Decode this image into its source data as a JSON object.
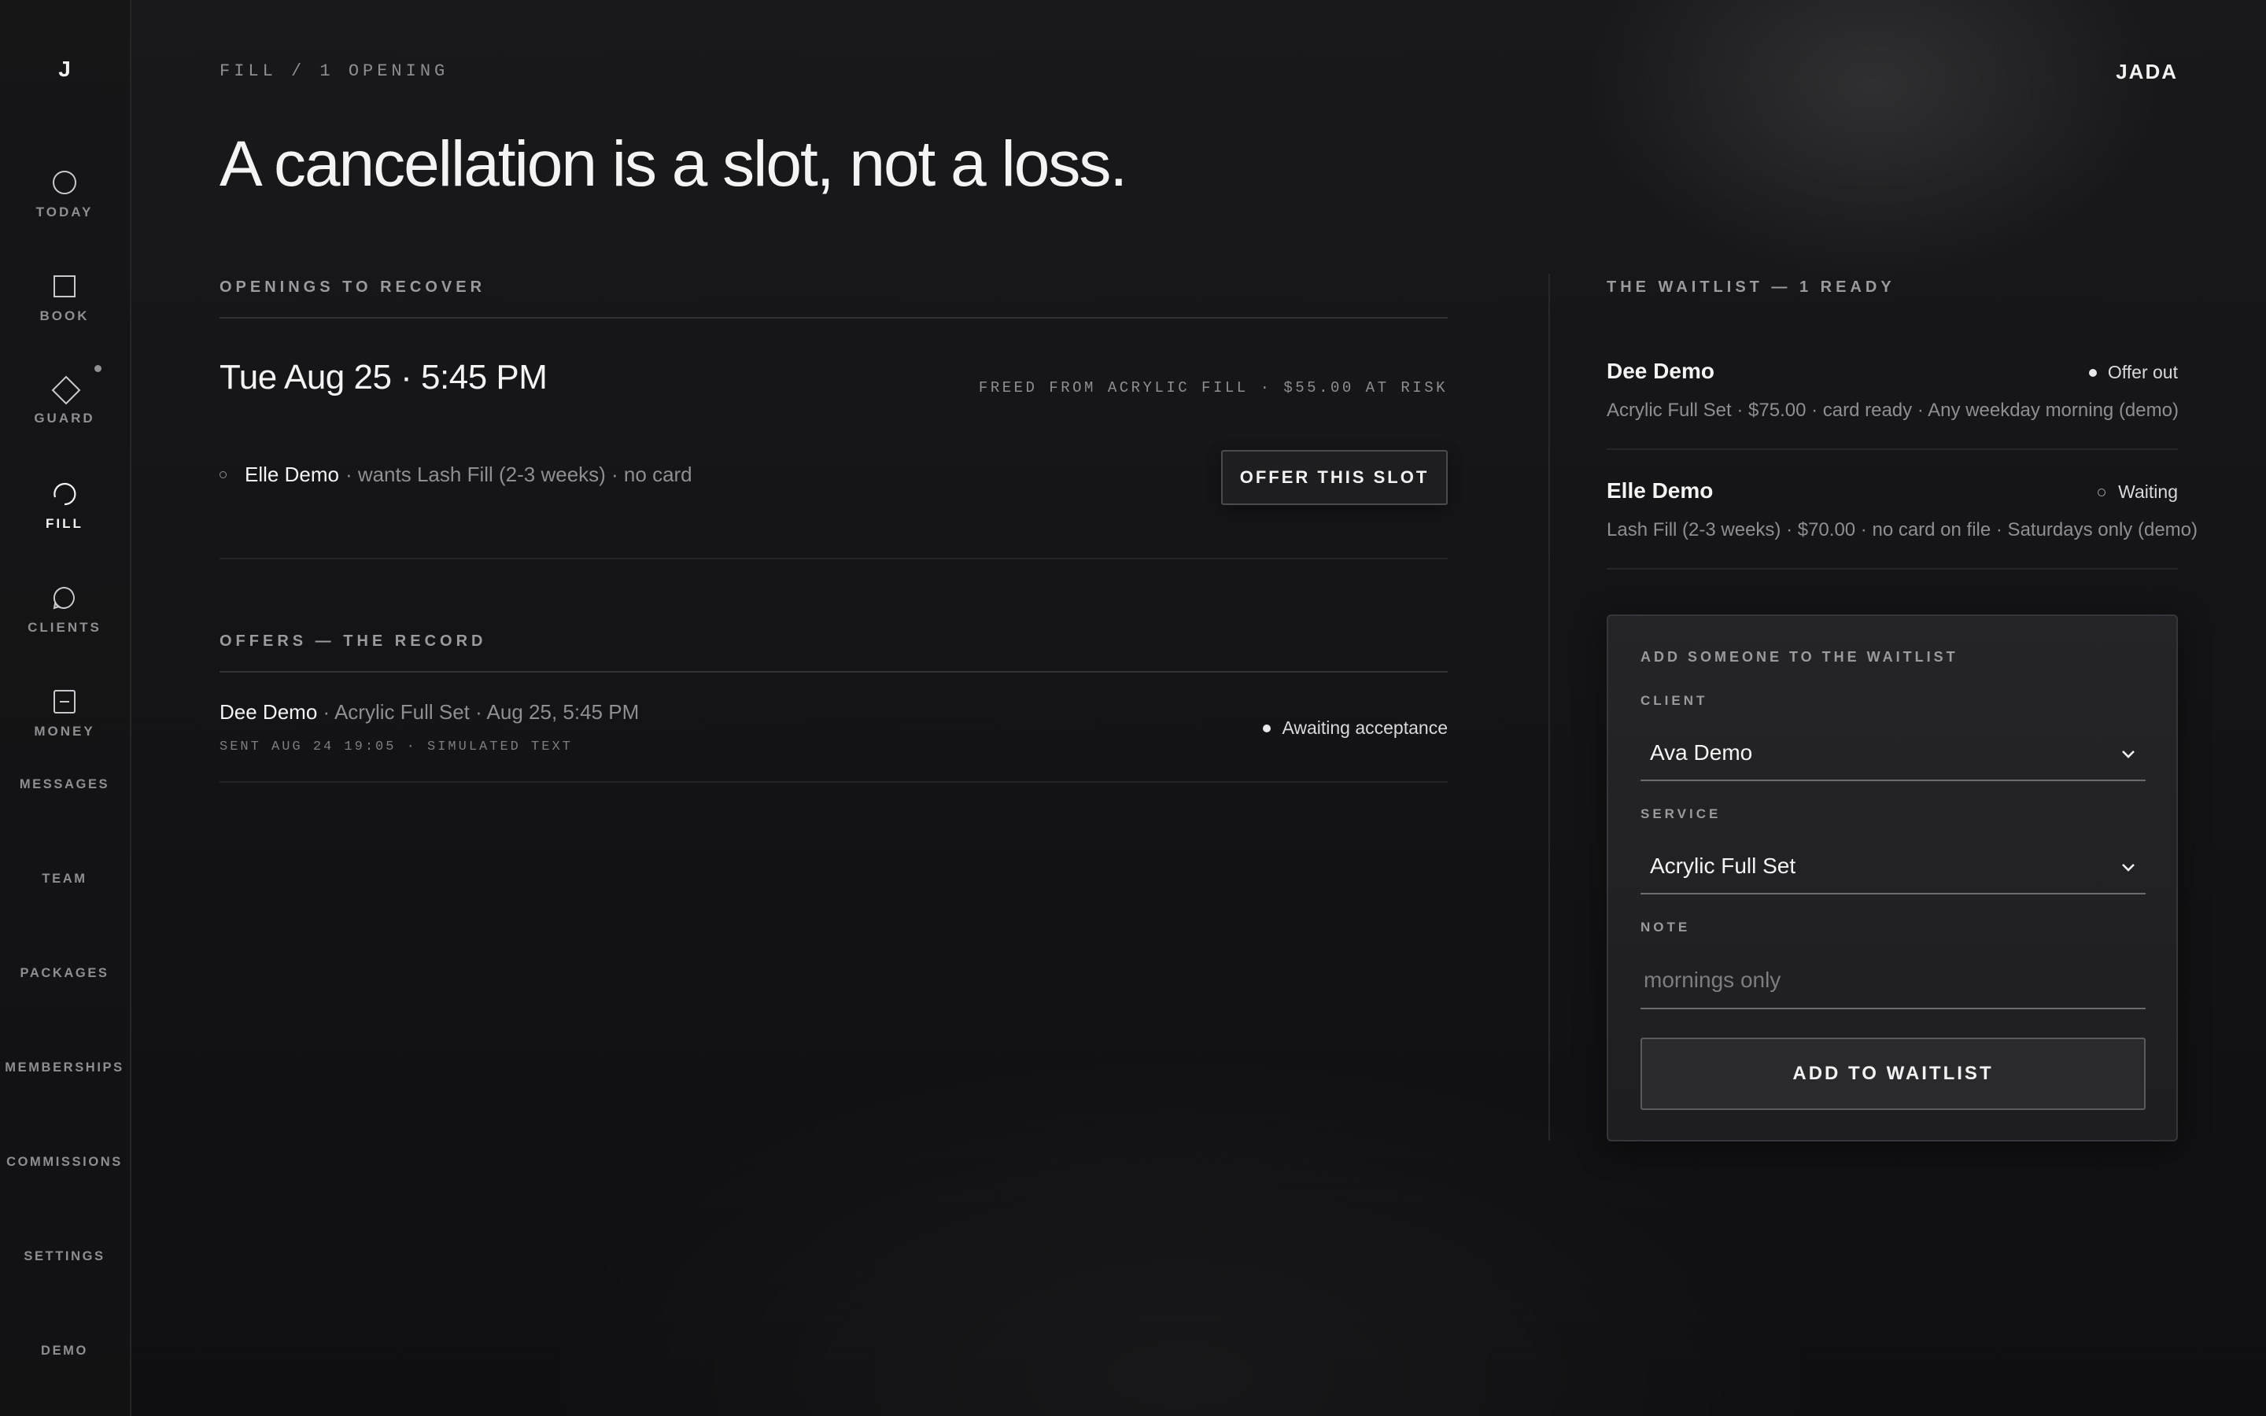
{
  "app": {
    "logo": "J",
    "brand": "JADA"
  },
  "sidebar": {
    "items": [
      {
        "label": "TODAY",
        "icon": "circle-icon"
      },
      {
        "label": "BOOK",
        "icon": "square-icon"
      },
      {
        "label": "GUARD",
        "icon": "diamond-icon"
      },
      {
        "label": "FILL",
        "icon": "refresh-arc-icon",
        "active": true
      },
      {
        "label": "CLIENTS",
        "icon": "chat-bubble-icon"
      },
      {
        "label": "MONEY",
        "icon": "minus-square-icon"
      },
      {
        "label": "MESSAGES"
      },
      {
        "label": "TEAM"
      },
      {
        "label": "PACKAGES"
      },
      {
        "label": "MEMBERSHIPS"
      },
      {
        "label": "COMMISSIONS"
      },
      {
        "label": "SETTINGS"
      },
      {
        "label": "DEMO"
      }
    ]
  },
  "header": {
    "breadcrumb": "FILL / 1 OPENING",
    "headline": "A cancellation is a slot, not a loss."
  },
  "openings": {
    "section_label": "OPENINGS TO RECOVER",
    "slot": {
      "datetime": "Tue Aug 25 · 5:45 PM",
      "meta": "FREED FROM ACRYLIC FILL · $55.00 AT RISK",
      "candidate_name": "Elle Demo",
      "candidate_detail": "· wants Lash Fill (2-3 weeks) · no card",
      "offer_button": "OFFER THIS SLOT"
    }
  },
  "offers": {
    "section_label": "OFFERS — THE RECORD",
    "rows": [
      {
        "name": "Dee Demo",
        "detail": " · Acrylic Full Set · Aug 25, 5:45 PM",
        "sent": "SENT AUG 24 19:05 · SIMULATED TEXT",
        "status": "Awaiting acceptance"
      }
    ]
  },
  "waitlist": {
    "section_label": "THE WAITLIST — 1 READY",
    "items": [
      {
        "name": "Dee Demo",
        "status": "Offer out",
        "detail": "Acrylic Full Set · $75.00 · card ready · Any weekday morning (demo)"
      },
      {
        "name": "Elle Demo",
        "status": "Waiting",
        "detail": "Lash Fill (2-3 weeks) · $70.00 · no card on file · Saturdays only (demo)"
      }
    ]
  },
  "add_form": {
    "title": "ADD SOMEONE TO THE WAITLIST",
    "client_label": "CLIENT",
    "client_value": "Ava Demo",
    "service_label": "SERVICE",
    "service_value": "Acrylic Full Set",
    "note_label": "NOTE",
    "note_placeholder": "mornings only",
    "submit_label": "ADD TO WAITLIST"
  },
  "colors": {
    "background": "#141416",
    "text": "#f4f4f5",
    "muted": "#8e8e93",
    "rule": "#323236"
  }
}
